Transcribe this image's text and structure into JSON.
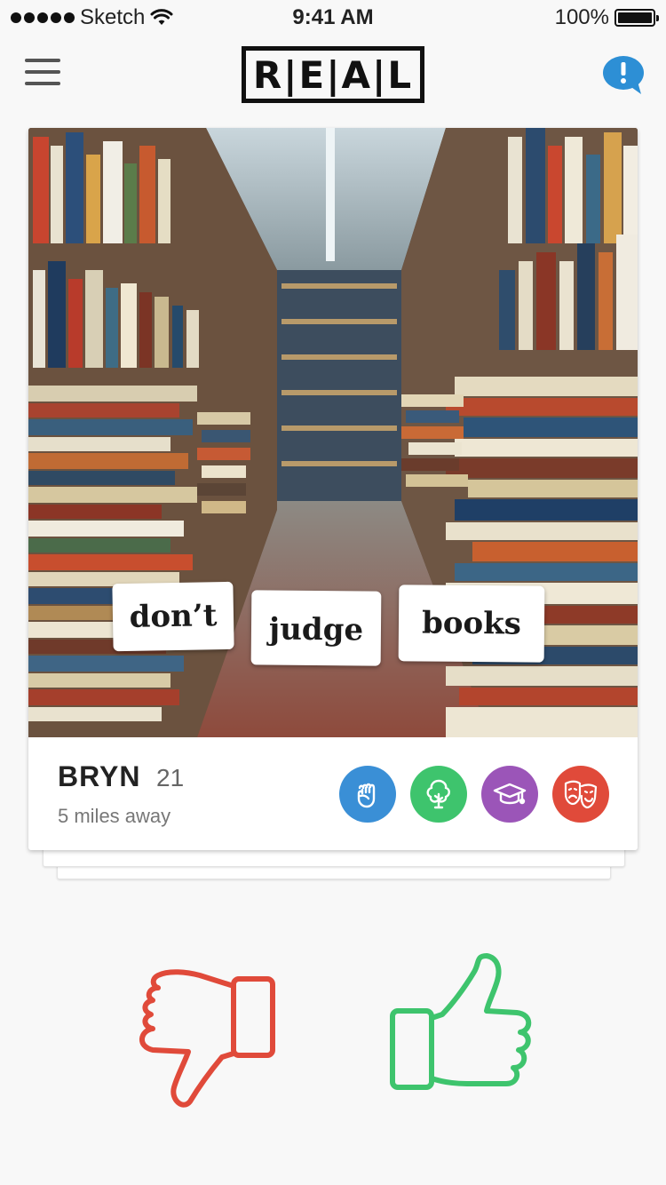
{
  "status_bar": {
    "carrier": "Sketch",
    "time": "9:41 AM",
    "battery": "100%"
  },
  "header": {
    "logo_text": "R|E|A|L",
    "menu_icon": "hamburger-menu-icon",
    "alert_icon": "exclamation-chat-bubble-icon"
  },
  "profile": {
    "name": "BRYN",
    "age": "21",
    "distance": "5 miles away",
    "photo_tags": [
      "don’t",
      "judge",
      "books"
    ],
    "interests": [
      {
        "icon": "fist-icon",
        "color": "#3a8fd6"
      },
      {
        "icon": "tree-icon",
        "color": "#3ec46d"
      },
      {
        "icon": "graduation-cap-icon",
        "color": "#9b55b8"
      },
      {
        "icon": "theater-masks-icon",
        "color": "#e04a3a"
      }
    ]
  },
  "actions": {
    "dislike_icon": "thumbs-down-icon",
    "dislike_color": "#e04a3a",
    "like_icon": "thumbs-up-icon",
    "like_color": "#3ec46d"
  }
}
